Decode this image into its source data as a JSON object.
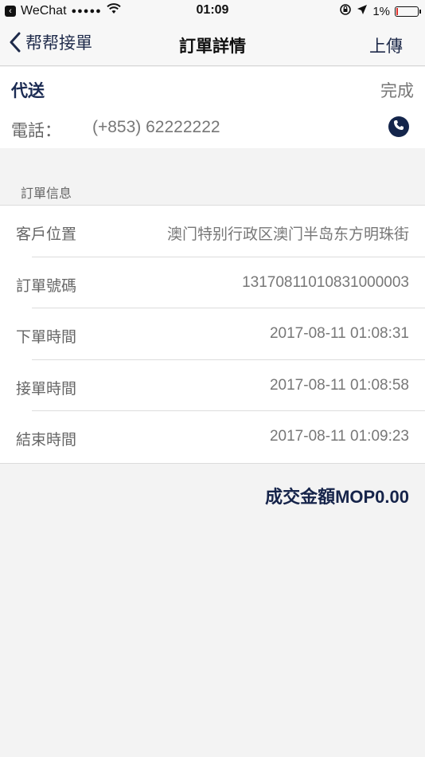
{
  "status_bar": {
    "carrier": "WeChat",
    "signal": "●●●●●",
    "time": "01:09",
    "battery": "1%",
    "battery_level": 0.01
  },
  "nav": {
    "back_label": "帮帮接單",
    "title": "訂單詳情",
    "action_label": "上傳"
  },
  "order": {
    "type": "代送",
    "status": "完成",
    "phone_label": "電話：",
    "phone_number": "(+853) 62222222"
  },
  "section_title": "訂單信息",
  "info_rows": [
    {
      "label": "客戶位置",
      "value": "澳门特别行政区澳门半岛东方明珠街"
    },
    {
      "label": "訂單號碼",
      "value": "13170811010831000003"
    },
    {
      "label": "下單時間",
      "value": "2017-08-11 01:08:31"
    },
    {
      "label": "接單時間",
      "value": "2017-08-11 01:08:58"
    },
    {
      "label": "結束時間",
      "value": "2017-08-11 01:09:23"
    }
  ],
  "total": "成交金額MOP0.00",
  "colors": {
    "accent": "#1a2a52",
    "battery_low": "#e0302a"
  }
}
